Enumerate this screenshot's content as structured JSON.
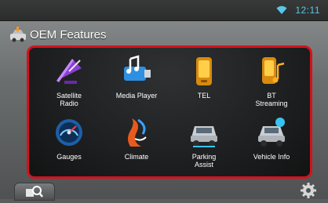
{
  "status": {
    "time": "12:11",
    "wifi_icon": "wifi-icon"
  },
  "header": {
    "title": "OEM Features",
    "icon": "car-toolbox-icon"
  },
  "features": [
    {
      "label": "Satellite\nRadio",
      "icon": "satellite-dish-icon"
    },
    {
      "label": "Media Player",
      "icon": "usb-music-icon"
    },
    {
      "label": "TEL",
      "icon": "phone-icon"
    },
    {
      "label": "BT\nStreaming",
      "icon": "bluetooth-music-icon"
    },
    {
      "label": "Gauges",
      "icon": "gauge-icon"
    },
    {
      "label": "Climate",
      "icon": "climate-icon"
    },
    {
      "label": "Parking\nAssist",
      "icon": "parking-assist-icon"
    },
    {
      "label": "Vehicle Info",
      "icon": "car-info-icon"
    }
  ],
  "bottom": {
    "search_icon": "search-icon",
    "settings_icon": "gear-icon"
  },
  "colors": {
    "accent": "#d2131e",
    "time": "#58c8e8"
  }
}
